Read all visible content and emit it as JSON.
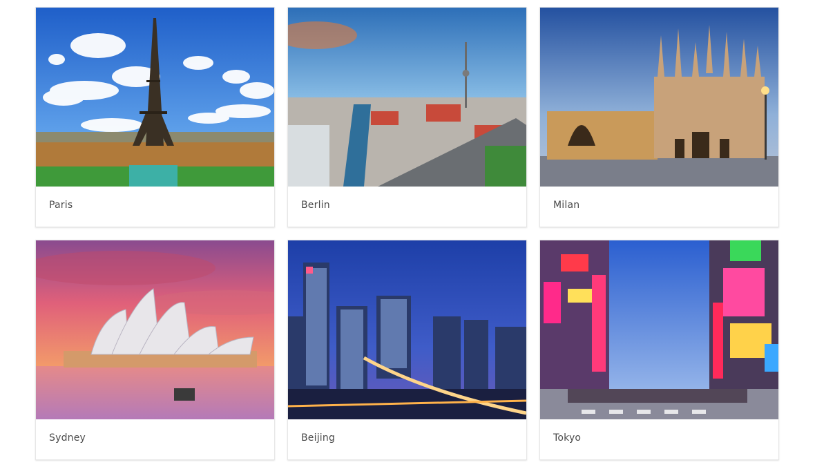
{
  "cities": [
    {
      "name": "Paris"
    },
    {
      "name": "Berlin"
    },
    {
      "name": "Milan"
    },
    {
      "name": "Sydney"
    },
    {
      "name": "Beijing"
    },
    {
      "name": "Tokyo"
    }
  ]
}
